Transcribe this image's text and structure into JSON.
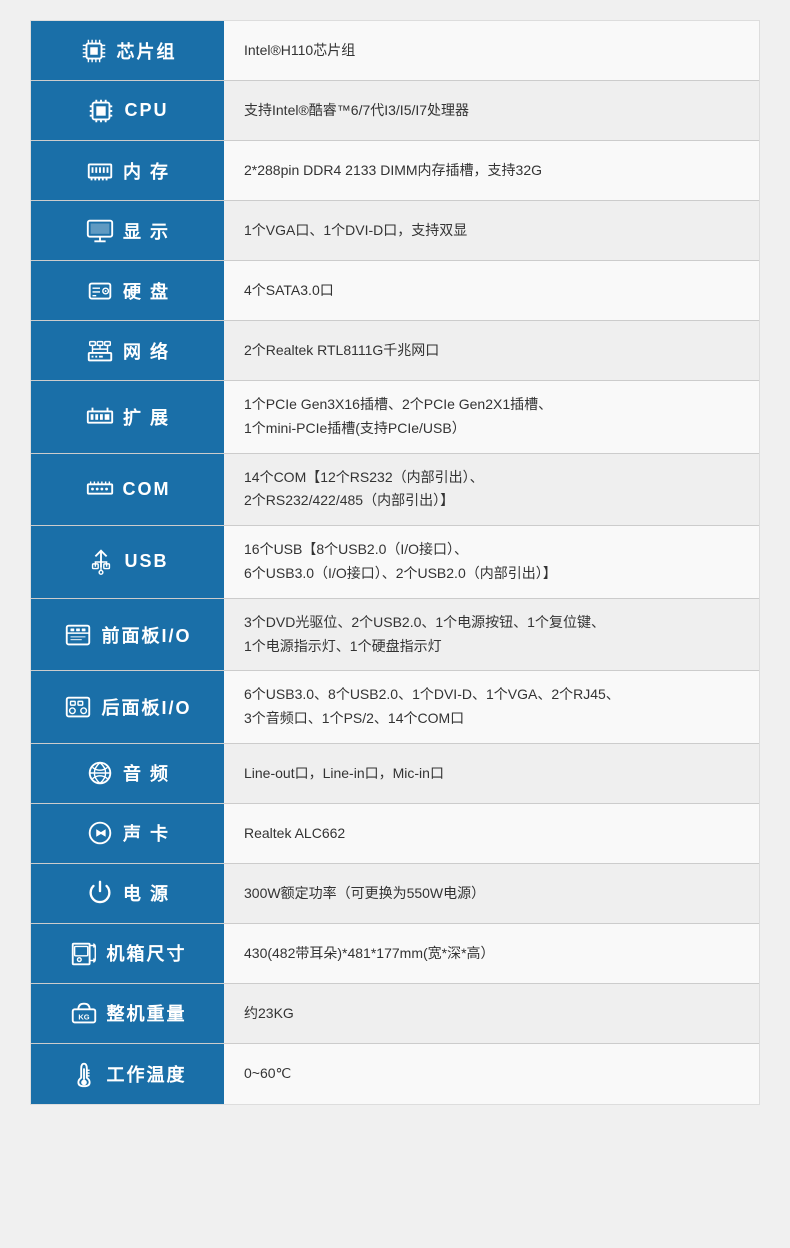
{
  "rows": [
    {
      "id": "chipset",
      "icon": "chipset",
      "label": "芯片组",
      "value": "Intel®H110芯片组"
    },
    {
      "id": "cpu",
      "icon": "cpu",
      "label": "CPU",
      "value": "支持Intel®酷睿™6/7代I3/I5/I7处理器"
    },
    {
      "id": "memory",
      "icon": "memory",
      "label": "内  存",
      "value": "2*288pin DDR4 2133 DIMM内存插槽，支持32G"
    },
    {
      "id": "display",
      "icon": "display",
      "label": "显  示",
      "value": "1个VGA口、1个DVI-D口，支持双显"
    },
    {
      "id": "harddisk",
      "icon": "harddisk",
      "label": "硬  盘",
      "value": "4个SATA3.0口"
    },
    {
      "id": "network",
      "icon": "network",
      "label": "网  络",
      "value": "2个Realtek RTL8111G千兆网口"
    },
    {
      "id": "expansion",
      "icon": "expansion",
      "label": "扩  展",
      "value": "1个PCIe Gen3X16插槽、2个PCIe Gen2X1插槽、\n1个mini-PCIe插槽(支持PCIe/USB）"
    },
    {
      "id": "com",
      "icon": "com",
      "label": "COM",
      "value": "14个COM【12个RS232（内部引出）、\n2个RS232/422/485（内部引出）】"
    },
    {
      "id": "usb",
      "icon": "usb",
      "label": "USB",
      "value": "16个USB【8个USB2.0（I/O接口）、\n6个USB3.0（I/O接口）、2个USB2.0（内部引出）】"
    },
    {
      "id": "frontio",
      "icon": "frontio",
      "label": "前面板I/O",
      "value": "3个DVD光驱位、2个USB2.0、1个电源按钮、1个复位键、\n1个电源指示灯、1个硬盘指示灯"
    },
    {
      "id": "reario",
      "icon": "reario",
      "label": "后面板I/O",
      "value": "6个USB3.0、8个USB2.0、1个DVI-D、1个VGA、2个RJ45、\n3个音频口、1个PS/2、14个COM口"
    },
    {
      "id": "audio",
      "icon": "audio",
      "label": "音  频",
      "value": "Line-out口，Line-in口，Mic-in口"
    },
    {
      "id": "soundcard",
      "icon": "soundcard",
      "label": "声  卡",
      "value": "Realtek ALC662"
    },
    {
      "id": "power",
      "icon": "power",
      "label": "电  源",
      "value": "300W额定功率（可更换为550W电源）"
    },
    {
      "id": "casesize",
      "icon": "casesize",
      "label": "机箱尺寸",
      "value": "430(482带耳朵)*481*177mm(宽*深*高）"
    },
    {
      "id": "weight",
      "icon": "weight",
      "label": "整机重量",
      "value": "约23KG"
    },
    {
      "id": "temperature",
      "icon": "temperature",
      "label": "工作温度",
      "value": "0~60℃"
    }
  ]
}
